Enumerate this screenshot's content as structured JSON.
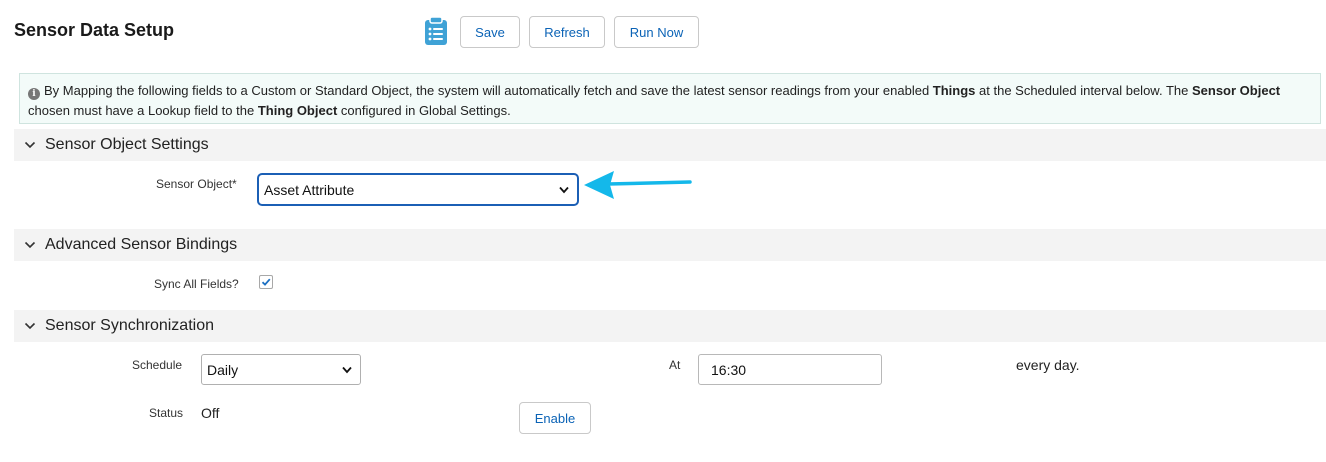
{
  "header": {
    "title": "Sensor Data Setup",
    "save_label": "Save",
    "refresh_label": "Refresh",
    "run_now_label": "Run Now",
    "icon": "clipboard-list-icon",
    "accent_color": "#3fa2d6"
  },
  "info": {
    "icon": "info-icon",
    "t1": "By Mapping the following fields to a Custom or Standard Object, the system will automatically fetch and save the latest sensor readings from your enabled ",
    "b1": "Things",
    "t2": " at the Scheduled interval below. The ",
    "b2": "Sensor Object",
    "t3": " chosen must have a Lookup field to the ",
    "b3": "Thing Object",
    "t4": " configured in Global Settings."
  },
  "sections": {
    "object_settings": {
      "title": "Sensor Object Settings",
      "sensor_object_label": "Sensor Object*",
      "sensor_object_value": "Asset Attribute"
    },
    "bindings": {
      "title": "Advanced Sensor Bindings",
      "sync_all_label": "Sync All Fields?",
      "sync_all_checked": true
    },
    "sync": {
      "title": "Sensor Synchronization",
      "schedule_label": "Schedule",
      "schedule_value": "Daily",
      "at_label": "At",
      "at_value": "16:30",
      "every_day_text": "every day.",
      "status_label": "Status",
      "status_value": "Off",
      "enable_label": "Enable"
    }
  },
  "annotation": {
    "arrow_color": "#14b8ea"
  }
}
